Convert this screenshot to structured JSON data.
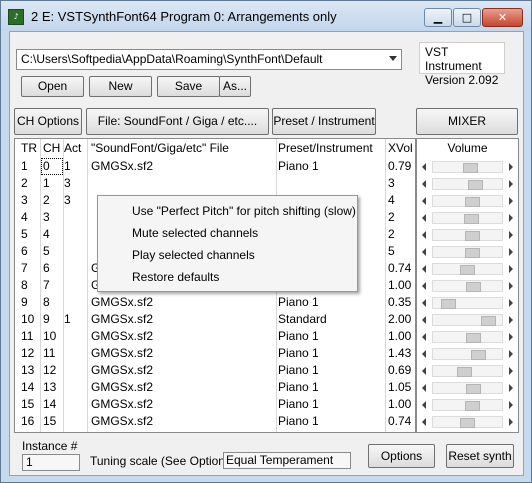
{
  "window": {
    "title": "2 E: VSTSynthFont64 Program 0: Arrangements only"
  },
  "toolbar": {
    "path": "C:\\Users\\Softpedia\\AppData\\Roaming\\SynthFont\\Default",
    "open_label": "Open",
    "new_label": "New",
    "save_label": "Save",
    "save_as_label": "As..."
  },
  "vst_info": {
    "line1": "VST Instrument",
    "line2": "Version 2.092"
  },
  "column_buttons": {
    "ch_options": "CH Options",
    "file": "File: SoundFont / Giga / etc....",
    "preset": "Preset / Instrument",
    "mixer": "MIXER"
  },
  "table": {
    "headers": [
      "TR",
      "CH",
      "Act",
      "\"SoundFont/Giga/etc\" File",
      "Preset/Instrument",
      "XVol"
    ],
    "rows": [
      {
        "tr": "1",
        "ch": "0",
        "act": "1",
        "file": "GMGSx.sf2",
        "preset": "Piano 1",
        "xvol": "0.79"
      },
      {
        "tr": "2",
        "ch": "1",
        "act": "3",
        "file": "",
        "preset": "",
        "xvol": "3"
      },
      {
        "tr": "3",
        "ch": "2",
        "act": "3",
        "file": "",
        "preset": "",
        "xvol": "4"
      },
      {
        "tr": "4",
        "ch": "3",
        "act": "",
        "file": "",
        "preset": "",
        "xvol": "2"
      },
      {
        "tr": "5",
        "ch": "4",
        "act": "",
        "file": "",
        "preset": "",
        "xvol": "2"
      },
      {
        "tr": "6",
        "ch": "5",
        "act": "",
        "file": "",
        "preset": "",
        "xvol": "5"
      },
      {
        "tr": "7",
        "ch": "6",
        "act": "",
        "file": "GMGSx.sf2",
        "preset": "Piano 1",
        "xvol": "0.74"
      },
      {
        "tr": "8",
        "ch": "7",
        "act": "",
        "file": "GMGSx.sf2",
        "preset": "Piano 1",
        "xvol": "1.00"
      },
      {
        "tr": "9",
        "ch": "8",
        "act": "",
        "file": "GMGSx.sf2",
        "preset": "Piano 1",
        "xvol": "0.35"
      },
      {
        "tr": "10",
        "ch": "9",
        "act": "1",
        "file": "GMGSx.sf2",
        "preset": "Standard",
        "xvol": "2.00"
      },
      {
        "tr": "11",
        "ch": "10",
        "act": "",
        "file": "GMGSx.sf2",
        "preset": "Piano 1",
        "xvol": "1.00"
      },
      {
        "tr": "12",
        "ch": "11",
        "act": "",
        "file": "GMGSx.sf2",
        "preset": "Piano 1",
        "xvol": "1.43"
      },
      {
        "tr": "13",
        "ch": "12",
        "act": "",
        "file": "GMGSx.sf2",
        "preset": "Piano 1",
        "xvol": "0.69"
      },
      {
        "tr": "14",
        "ch": "13",
        "act": "",
        "file": "GMGSx.sf2",
        "preset": "Piano 1",
        "xvol": "1.05"
      },
      {
        "tr": "15",
        "ch": "14",
        "act": "",
        "file": "GMGSx.sf2",
        "preset": "Piano 1",
        "xvol": "1.00"
      },
      {
        "tr": "16",
        "ch": "15",
        "act": "",
        "file": "GMGSx.sf2",
        "preset": "Piano 1",
        "xvol": "0.74"
      }
    ]
  },
  "mixer": {
    "header": "Volume",
    "levels": [
      0.55,
      0.65,
      0.6,
      0.58,
      0.6,
      0.6,
      0.5,
      0.62,
      0.15,
      0.88,
      0.62,
      0.7,
      0.45,
      0.62,
      0.6,
      0.5
    ]
  },
  "context_menu": {
    "items": [
      "Use \"Perfect Pitch\" for pitch shifting (slow)",
      "Mute selected channels",
      "Play selected channels",
      "Restore defaults"
    ]
  },
  "footer": {
    "instance_label": "Instance #",
    "instance_value": "1",
    "tuning_label": "Tuning scale (See Options)",
    "tuning_value": "Equal Temperament",
    "options_label": "Options",
    "reset_label": "Reset synth"
  },
  "icons": {
    "app": "app-icon",
    "minimize": "minimize-icon",
    "maximize": "maximize-icon",
    "close": "close-icon"
  }
}
